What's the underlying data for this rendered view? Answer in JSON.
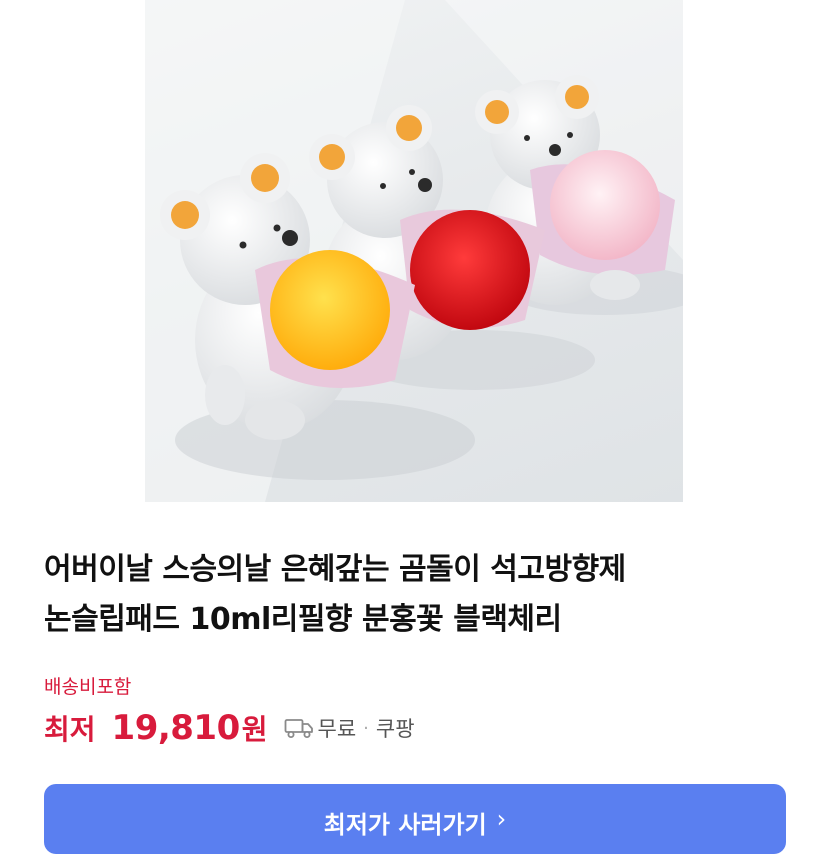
{
  "product": {
    "image_alt": "곰돌이 석고방향제",
    "title_line1": "어버이날 스승의날 은혜갚는 곰돌이 석고방향제",
    "title_line2": "논슬립패드 10ml리필향 분홍꽃 블랙체리"
  },
  "shipping": {
    "note": "배송비포함"
  },
  "price": {
    "prefix": "최저",
    "value": "19,810",
    "unit": "원",
    "free_shipping": "무료",
    "separator": "·",
    "seller": "쿠팡"
  },
  "cta": {
    "label": "최저가 사러가기",
    "chevron": "›"
  },
  "icons": {
    "expand": "expand-icon",
    "truck": "truck-icon"
  },
  "colors": {
    "price_red": "#d81b3c",
    "button_blue": "#5a7ff0",
    "flower_yellow": "#ffc21a",
    "flower_red": "#e0141c",
    "flower_pink": "#f6c9d6"
  }
}
